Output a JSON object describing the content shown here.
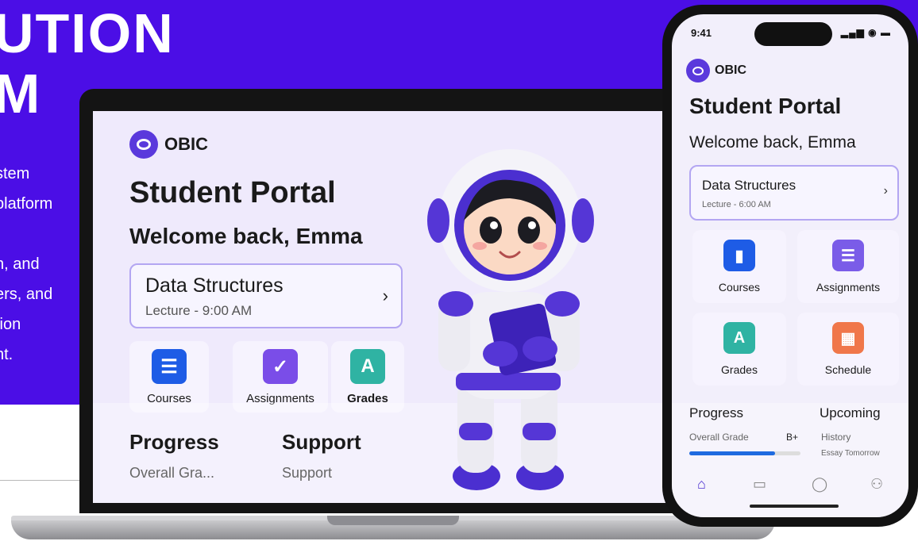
{
  "banner": {
    "title_lines": [
      "UTION",
      "M"
    ],
    "description_lines": [
      "stem",
      "platform",
      ".",
      "n, and",
      "ers, and",
      "tion",
      "nt."
    ]
  },
  "laptop": {
    "logo_text": "OBIC",
    "title": "Student Portal",
    "welcome": "Welcome back, Emma",
    "class_card": {
      "title": "Data Structures",
      "subtitle": "Lecture - 9:00 AM",
      "chevron": "›"
    },
    "tiles": [
      {
        "label": "Courses",
        "icon": "courses-icon",
        "glyph": "☰",
        "color": "#1e5ce6"
      },
      {
        "label": "Assignments",
        "icon": "assignments-icon",
        "glyph": "✓",
        "color": "#7a4de8"
      },
      {
        "label": "Grades",
        "icon": "grades-icon",
        "glyph": "A",
        "color": "#2fb3a3"
      }
    ],
    "progress_heading": "Progress",
    "progress_sub": "Overall Gra...",
    "support_heading": "Support",
    "support_sub": "Support"
  },
  "phone": {
    "time": "9:41",
    "status_icons": "▂▄▆ ◉ ▬",
    "logo_text": "OBIC",
    "title": "Student Portal",
    "welcome": "Welcome back, Emma",
    "class_card": {
      "title": "Data Structures",
      "subtitle": "Lecture - 6:00 AM",
      "chevron": "›"
    },
    "tiles": [
      {
        "label": "Courses",
        "icon": "courses-icon",
        "glyph": "▮",
        "color": "#1e5ce6"
      },
      {
        "label": "Assignments",
        "icon": "assignments-icon",
        "glyph": "☰",
        "color": "#7a5ce8"
      },
      {
        "label": "Grades",
        "icon": "grades-icon",
        "glyph": "A",
        "color": "#2fb3a3"
      },
      {
        "label": "Schedule",
        "icon": "schedule-icon",
        "glyph": "▦",
        "color": "#f0774a"
      }
    ],
    "progress_heading": "Progress",
    "overall_grade_label": "Overall Grade",
    "overall_grade_value": "B+",
    "overall_progress": 0.77,
    "upcoming_heading": "Upcoming",
    "upcoming_item": "History",
    "upcoming_detail": "Essay Tomorrow",
    "nav": [
      {
        "icon": "home-icon",
        "glyph": "⌂"
      },
      {
        "icon": "calendar-icon",
        "glyph": "▭"
      },
      {
        "icon": "chat-icon",
        "glyph": "◯"
      },
      {
        "icon": "profile-icon",
        "glyph": "⚇"
      }
    ]
  },
  "colors": {
    "brand": "#4b0ee6",
    "accent": "#5a39dc",
    "card_border": "#b3a6f2"
  }
}
